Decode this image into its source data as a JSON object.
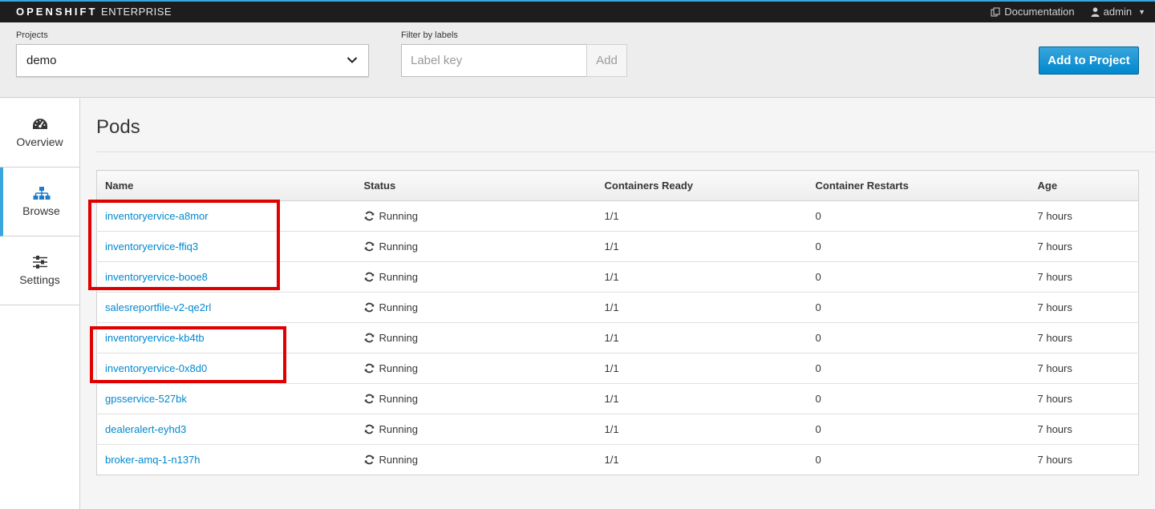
{
  "navbar": {
    "brand_bold": "OPENSHIFT",
    "brand_light": "ENTERPRISE",
    "documentation": "Documentation",
    "user": "admin"
  },
  "project_bar": {
    "projects_label": "Projects",
    "project_value": "demo",
    "filter_label": "Filter by labels",
    "filter_placeholder": "Label key",
    "add_label": "Add",
    "add_to_project": "Add to Project"
  },
  "sidebar": {
    "items": [
      {
        "label": "Overview",
        "icon": "dashboard-icon",
        "active": false
      },
      {
        "label": "Browse",
        "icon": "sitemap-icon",
        "active": true
      },
      {
        "label": "Settings",
        "icon": "sliders-icon",
        "active": false
      }
    ]
  },
  "main": {
    "title": "Pods",
    "columns": [
      "Name",
      "Status",
      "Containers Ready",
      "Container Restarts",
      "Age"
    ],
    "rows": [
      {
        "name": "inventoryervice-a8mor",
        "status": "Running",
        "ready": "1/1",
        "restarts": "0",
        "age": "7 hours"
      },
      {
        "name": "inventoryervice-ffiq3",
        "status": "Running",
        "ready": "1/1",
        "restarts": "0",
        "age": "7 hours"
      },
      {
        "name": "inventoryervice-booe8",
        "status": "Running",
        "ready": "1/1",
        "restarts": "0",
        "age": "7 hours"
      },
      {
        "name": "salesreportfile-v2-qe2rl",
        "status": "Running",
        "ready": "1/1",
        "restarts": "0",
        "age": "7 hours"
      },
      {
        "name": "inventoryervice-kb4tb",
        "status": "Running",
        "ready": "1/1",
        "restarts": "0",
        "age": "7 hours"
      },
      {
        "name": "inventoryervice-0x8d0",
        "status": "Running",
        "ready": "1/1",
        "restarts": "0",
        "age": "7 hours"
      },
      {
        "name": "gpsservice-527bk",
        "status": "Running",
        "ready": "1/1",
        "restarts": "0",
        "age": "7 hours"
      },
      {
        "name": "dealeralert-eyhd3",
        "status": "Running",
        "ready": "1/1",
        "restarts": "0",
        "age": "7 hours"
      },
      {
        "name": "broker-amq-1-n137h",
        "status": "Running",
        "ready": "1/1",
        "restarts": "0",
        "age": "7 hours"
      }
    ]
  },
  "colors": {
    "accent": "#39a5dc",
    "link": "#0088ce",
    "primary_button": "#1f7ccd",
    "highlight": "#e00000"
  }
}
